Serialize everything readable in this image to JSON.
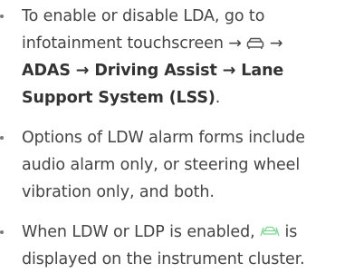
{
  "bullets": [
    {
      "parts": {
        "p1": "To enable or disable LDA, go to",
        "p2": "infotainment touchscreen →",
        "p3": "→",
        "p4": "ADAS → Driving Assist → Lane",
        "p5": "Support System (LSS)",
        "p6": "."
      },
      "icon": "car-icon"
    },
    {
      "lines": [
        "Options of LDW alarm forms include",
        "audio alarm only, or steering wheel",
        "vibration only, and both."
      ]
    },
    {
      "parts": {
        "p1": "When LDW or LDP is enabled,",
        "p2": "is",
        "p3": "displayed on the instrument cluster."
      },
      "icon": "lane-departure-icon",
      "icon_color": "#7bd88f"
    }
  ]
}
